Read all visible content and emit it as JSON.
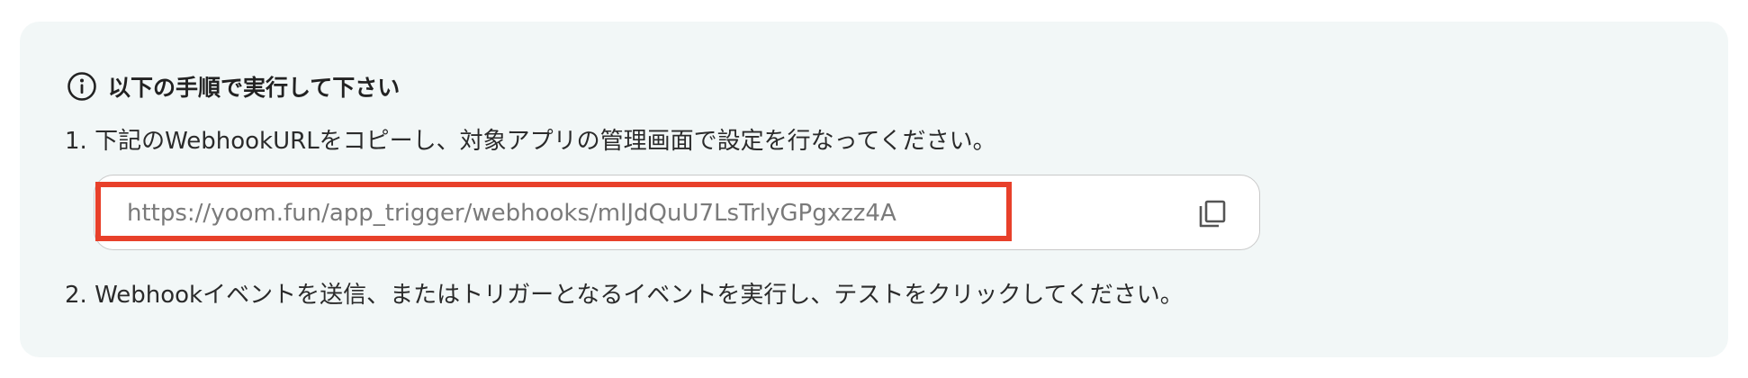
{
  "instructions": {
    "heading": "以下の手順で実行して下さい",
    "step1": "1. 下記のWebhookURLをコピーし、対象アプリの管理画面で設定を行なってください。",
    "step2": "2. Webhookイベントを送信、またはトリガーとなるイベントを実行し、テストをクリックしてください。"
  },
  "webhook": {
    "url": "https://yoom.fun/app_trigger/webhooks/mlJdQuU7LsTrlyGPgxzz4A",
    "copy_icon": "copy-icon"
  },
  "icons": {
    "info": "info-icon"
  },
  "colors": {
    "panel_background": "#f2f7f7",
    "highlight": "#e8402a",
    "url_text": "#7a7a7a"
  }
}
